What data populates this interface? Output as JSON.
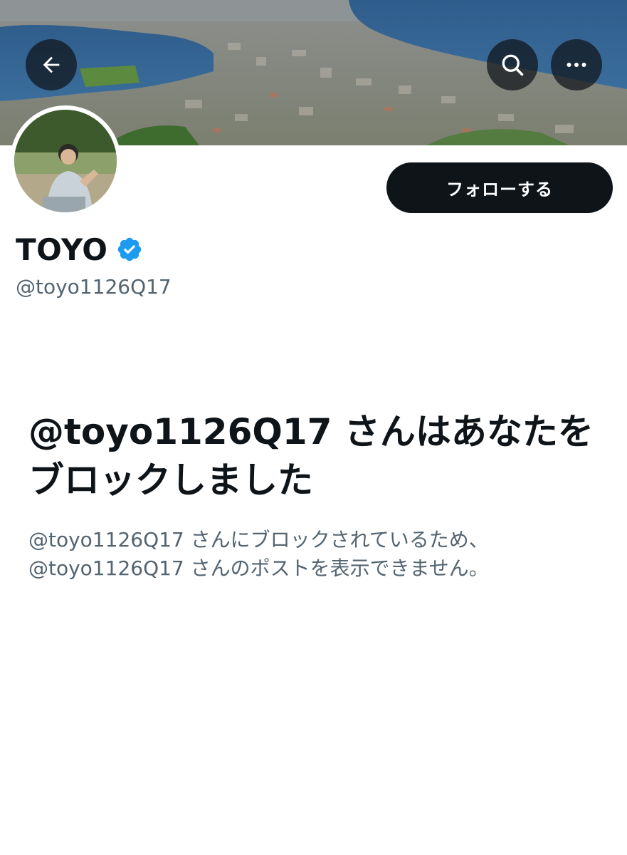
{
  "header": {
    "back_icon": "arrow-left-icon",
    "search_icon": "search-icon",
    "more_icon": "more-horizontal-icon"
  },
  "profile": {
    "display_name": "TOYO",
    "verified_icon": "verified-badge-icon",
    "verified_color": "#1d9bf0",
    "handle": "@toyo1126Q17",
    "follow_label": "フォローする"
  },
  "blocked": {
    "title": "@toyo1126Q17 さんはあなたをブロックしました",
    "description_lines": [
      "@toyo1126Q17 さんにブロックされているため、",
      "@toyo1126Q17 さんのポストを表示できません。"
    ]
  },
  "colors": {
    "text_primary": "#0f1419",
    "text_secondary": "#536471",
    "button_dark": "#0f1419",
    "accent": "#1d9bf0"
  }
}
